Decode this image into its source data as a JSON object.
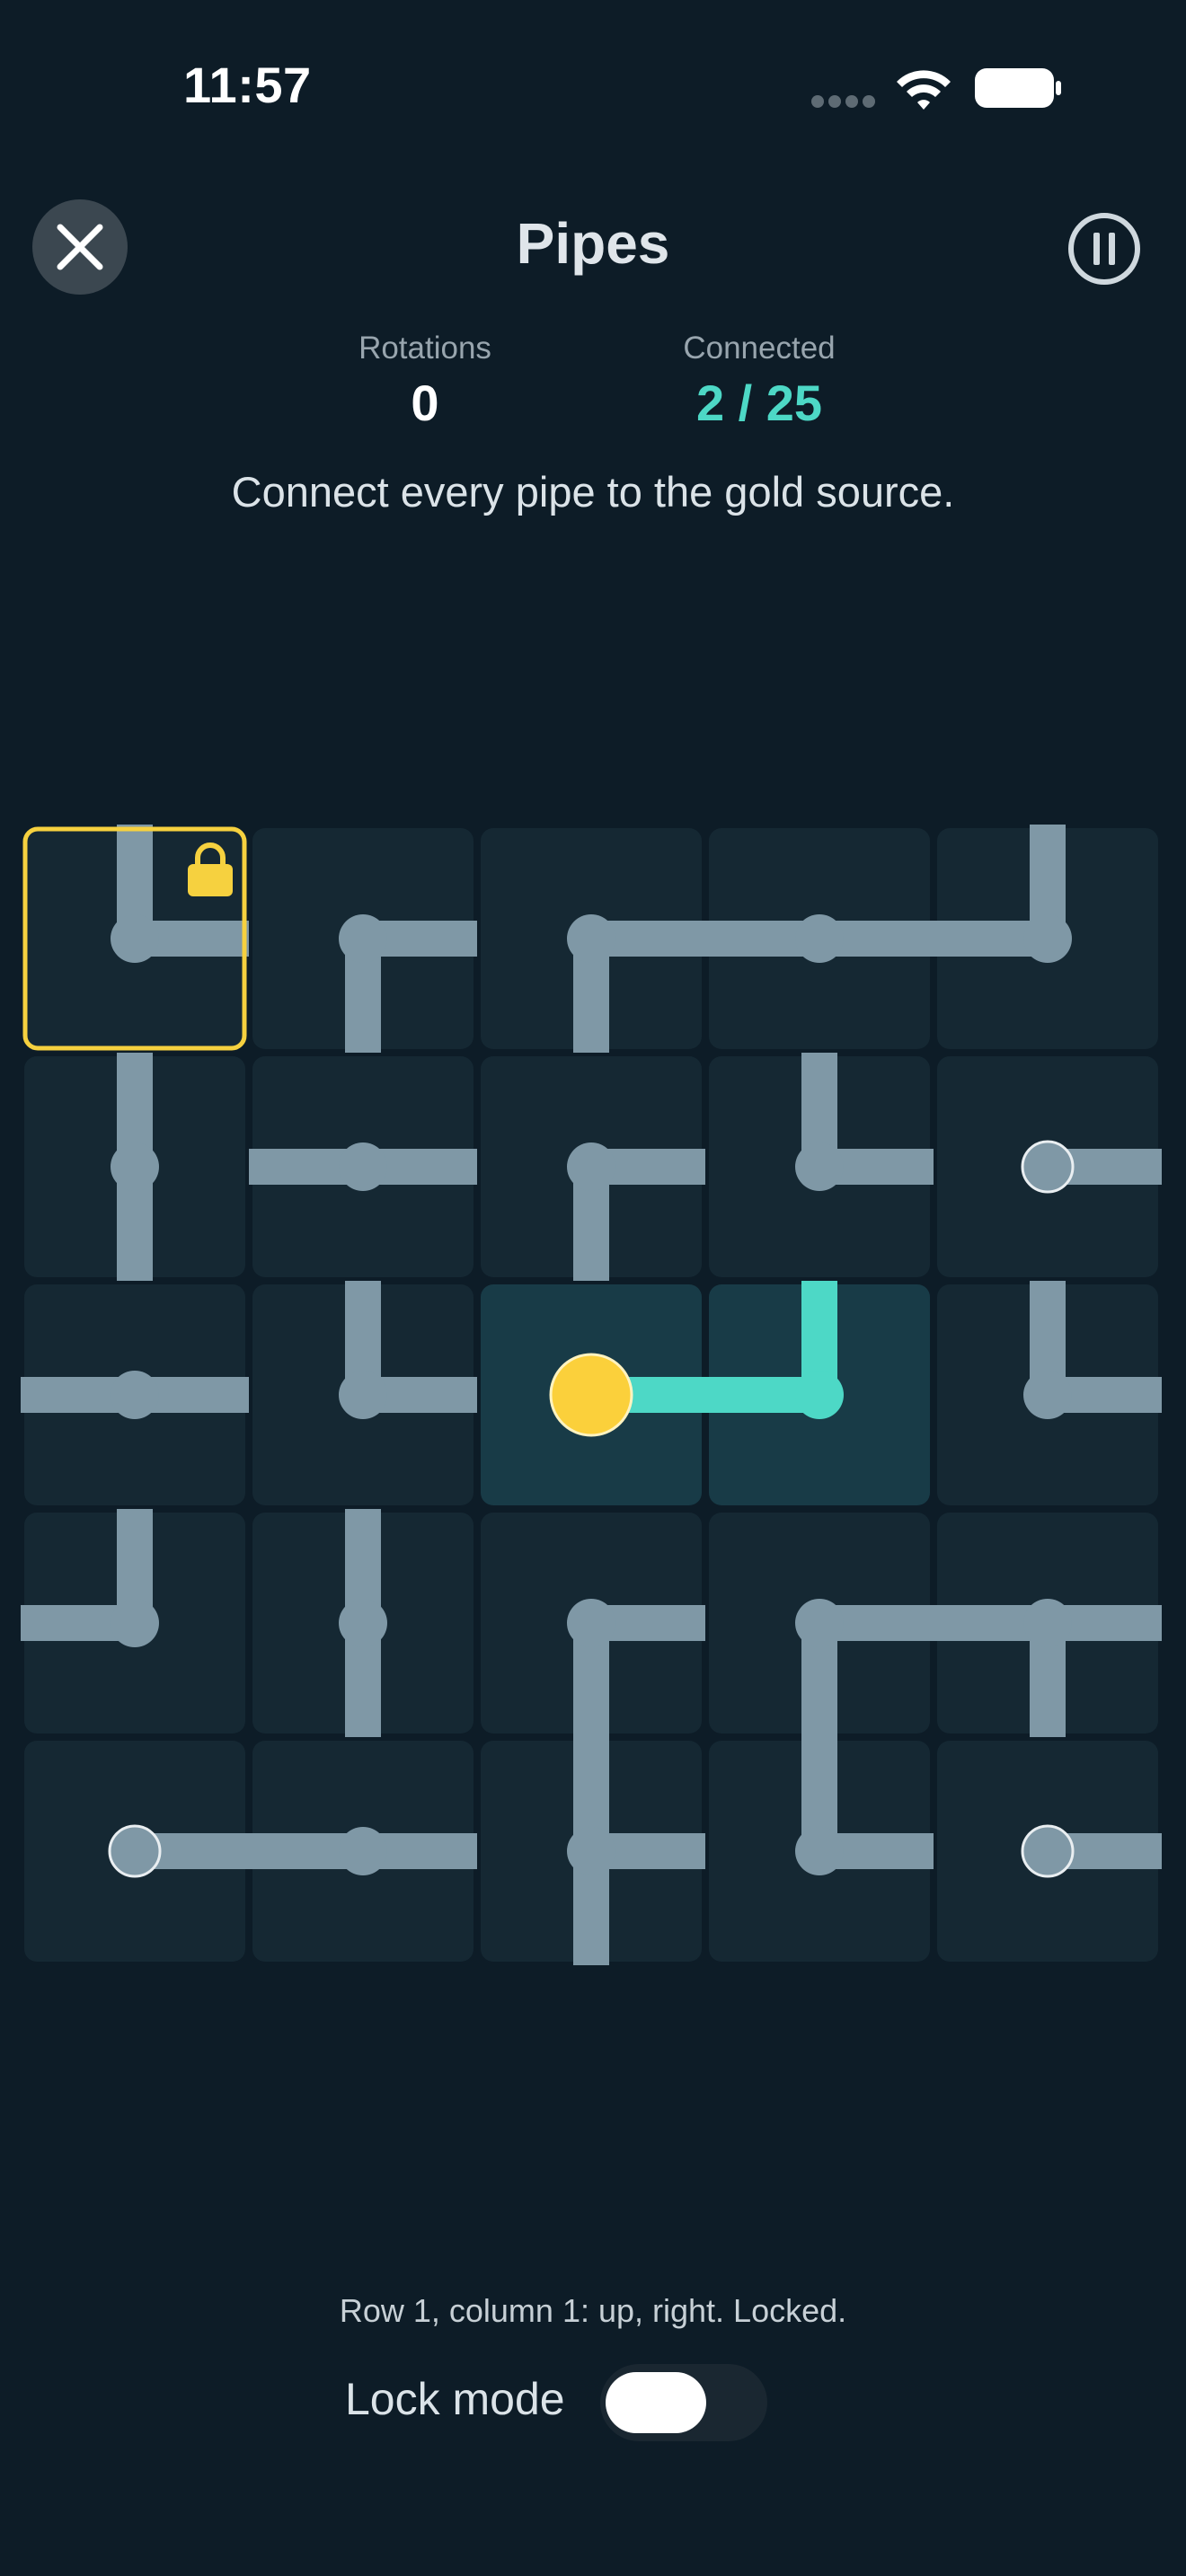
{
  "status_bar": {
    "time": "11:57",
    "wifi_icon": "wifi-icon",
    "battery_icon": "battery-icon",
    "signal_icon": "cellular-signal-icon"
  },
  "header": {
    "title": "Pipes",
    "close_icon": "close-icon",
    "pause_icon": "pause-icon"
  },
  "stats": {
    "rotations_label": "Rotations",
    "rotations_value": "0",
    "connected_label": "Connected",
    "connected_value": "2 / 25"
  },
  "instruction": "Connect every pipe to the gold source.",
  "board": {
    "rows": 5,
    "cols": 5,
    "colors": {
      "tile": "#152833",
      "tile_lit": "#183b47",
      "pipe": "#7f98a6",
      "pipe_lit": "#4dd8c6",
      "source": "#fbd03b",
      "selected_outline": "#f6d13f",
      "lock_icon": "#f6d13f"
    },
    "tiles": [
      [
        {
          "type": "elbow",
          "exits": [
            "up",
            "right"
          ],
          "locked": true,
          "selected": true
        },
        {
          "type": "elbow",
          "exits": [
            "right",
            "down"
          ]
        },
        {
          "type": "elbow",
          "exits": [
            "right",
            "down"
          ]
        },
        {
          "type": "straight",
          "exits": [
            "left",
            "right"
          ]
        },
        {
          "type": "elbow",
          "exits": [
            "up",
            "left"
          ]
        }
      ],
      [
        {
          "type": "straight",
          "exits": [
            "up",
            "down"
          ]
        },
        {
          "type": "straight",
          "exits": [
            "left",
            "right"
          ]
        },
        {
          "type": "elbow",
          "exits": [
            "right",
            "down"
          ]
        },
        {
          "type": "elbow",
          "exits": [
            "up",
            "right"
          ]
        },
        {
          "type": "endpoint",
          "exits": [
            "right"
          ]
        }
      ],
      [
        {
          "type": "straight",
          "exits": [
            "left",
            "right"
          ]
        },
        {
          "type": "elbow",
          "exits": [
            "up",
            "right"
          ]
        },
        {
          "type": "source",
          "exits": [
            "right"
          ],
          "lit": true
        },
        {
          "type": "elbow",
          "exits": [
            "up",
            "left"
          ],
          "lit": true
        },
        {
          "type": "elbow",
          "exits": [
            "up",
            "right"
          ]
        }
      ],
      [
        {
          "type": "elbow",
          "exits": [
            "up",
            "left"
          ]
        },
        {
          "type": "straight",
          "exits": [
            "up",
            "down"
          ]
        },
        {
          "type": "elbow",
          "exits": [
            "right",
            "down"
          ]
        },
        {
          "type": "elbow",
          "exits": [
            "right",
            "down"
          ]
        },
        {
          "type": "tee",
          "exits": [
            "left",
            "right",
            "down"
          ]
        }
      ],
      [
        {
          "type": "endpoint",
          "exits": [
            "right"
          ]
        },
        {
          "type": "straight",
          "exits": [
            "left",
            "right"
          ]
        },
        {
          "type": "tee",
          "exits": [
            "up",
            "right",
            "down"
          ]
        },
        {
          "type": "elbow",
          "exits": [
            "up",
            "right"
          ]
        },
        {
          "type": "endpoint",
          "exits": [
            "right"
          ]
        }
      ]
    ],
    "lock_icon": "lock-icon"
  },
  "status_line": "Row 1, column 1: up, right. Locked.",
  "lock_mode": {
    "label": "Lock mode",
    "on": false
  }
}
